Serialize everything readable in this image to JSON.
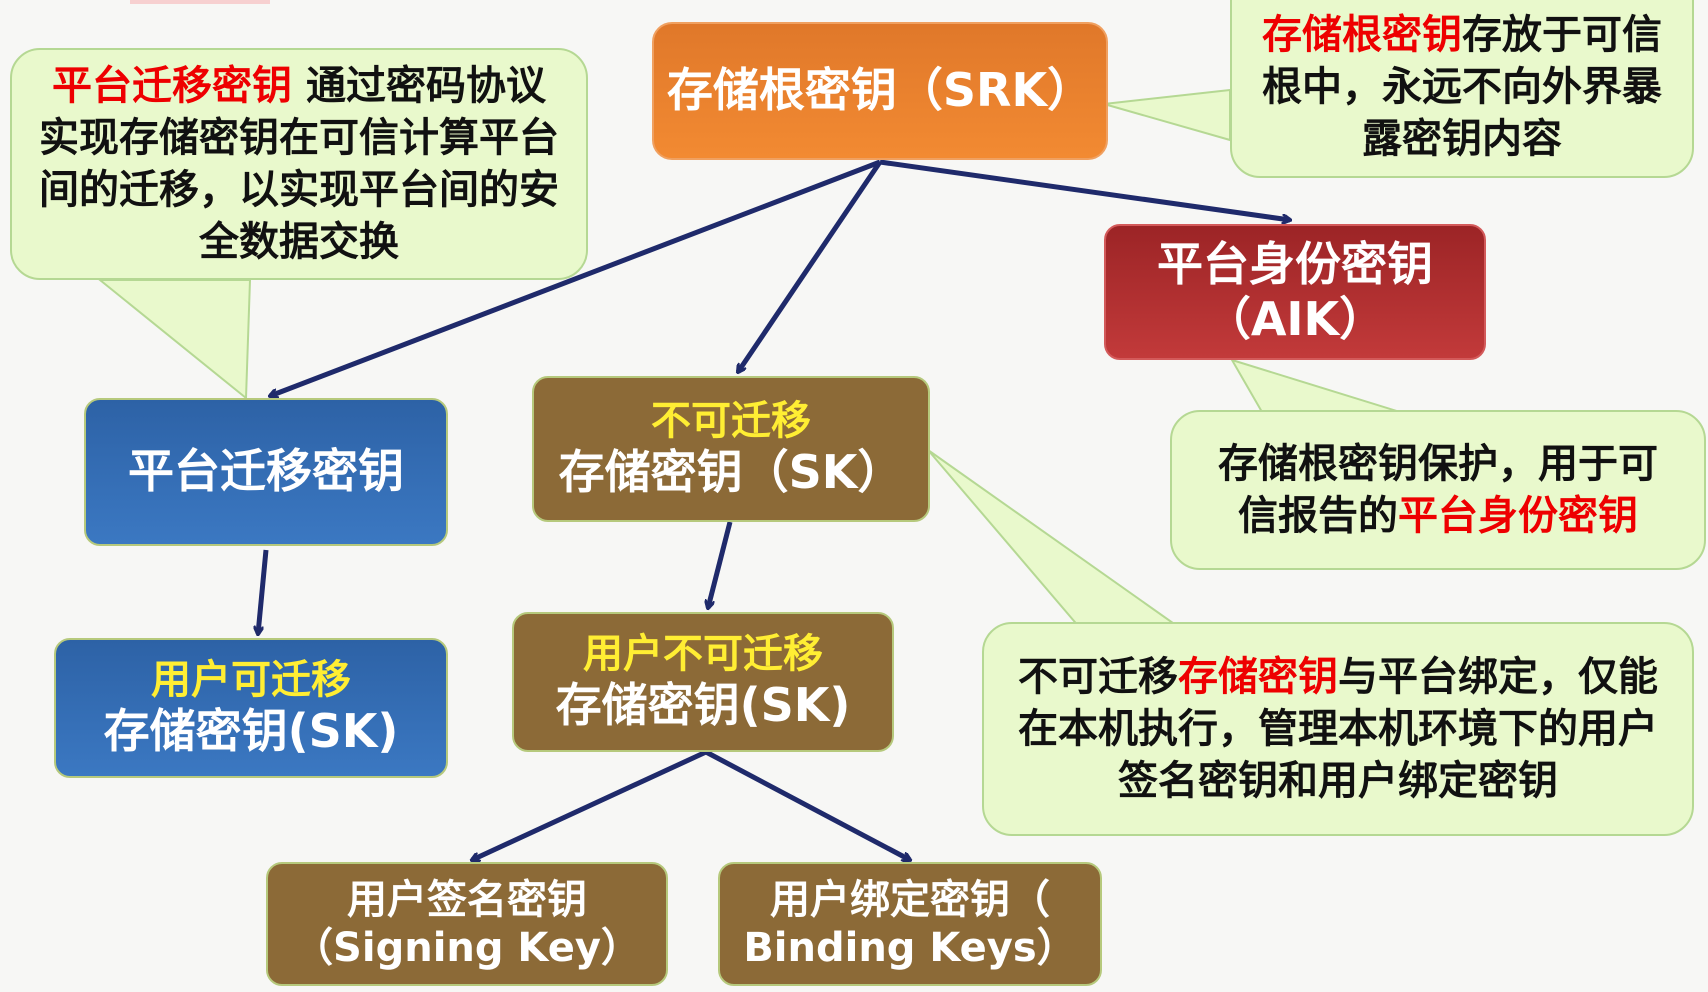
{
  "nodes": {
    "srk": "存储根密钥（SRK）",
    "aik_line1": "平台身份密钥",
    "aik_line2": "（AIK）",
    "migratable": "平台迁移密钥",
    "nonmig_line1": "不可迁移",
    "nonmig_line2": "存储密钥（SK）",
    "user_mig_line1": "用户可迁移",
    "user_mig_line2": "存储密钥(SK)",
    "user_nonmig_line1": "用户不可迁移",
    "user_nonmig_line2": "存储密钥(SK)",
    "signing_line1": "用户签名密钥",
    "signing_line2": "（Signing Key）",
    "binding_line1": "用户绑定密钥（",
    "binding_line2": "Binding Keys）"
  },
  "callouts": {
    "migration": {
      "highlight": "平台迁移密钥",
      "rest": " 通过密码协议实现存储密钥在可信计算平台间的迁移，以实现平台间的安全数据交换"
    },
    "srk": {
      "highlight": "存储根密钥",
      "rest": "存放于可信根中，永远不向外界暴露密钥内容"
    },
    "aik": {
      "text": "存储根密钥保护，用于可信报告的",
      "highlight": "平台身份密钥"
    },
    "nonmig": {
      "prefix": "不可迁移",
      "highlight": "存储密钥",
      "rest": "与平台绑定，仅能在本机执行，管理本机环境下的用户签名密钥和用户绑定密钥"
    }
  },
  "colors": {
    "arrow": "#1f2a6b",
    "highlight": "#ee0000",
    "yellow_text": "#ffee33",
    "callout_fill": "#e9f9cc",
    "callout_border": "#b5d893"
  }
}
